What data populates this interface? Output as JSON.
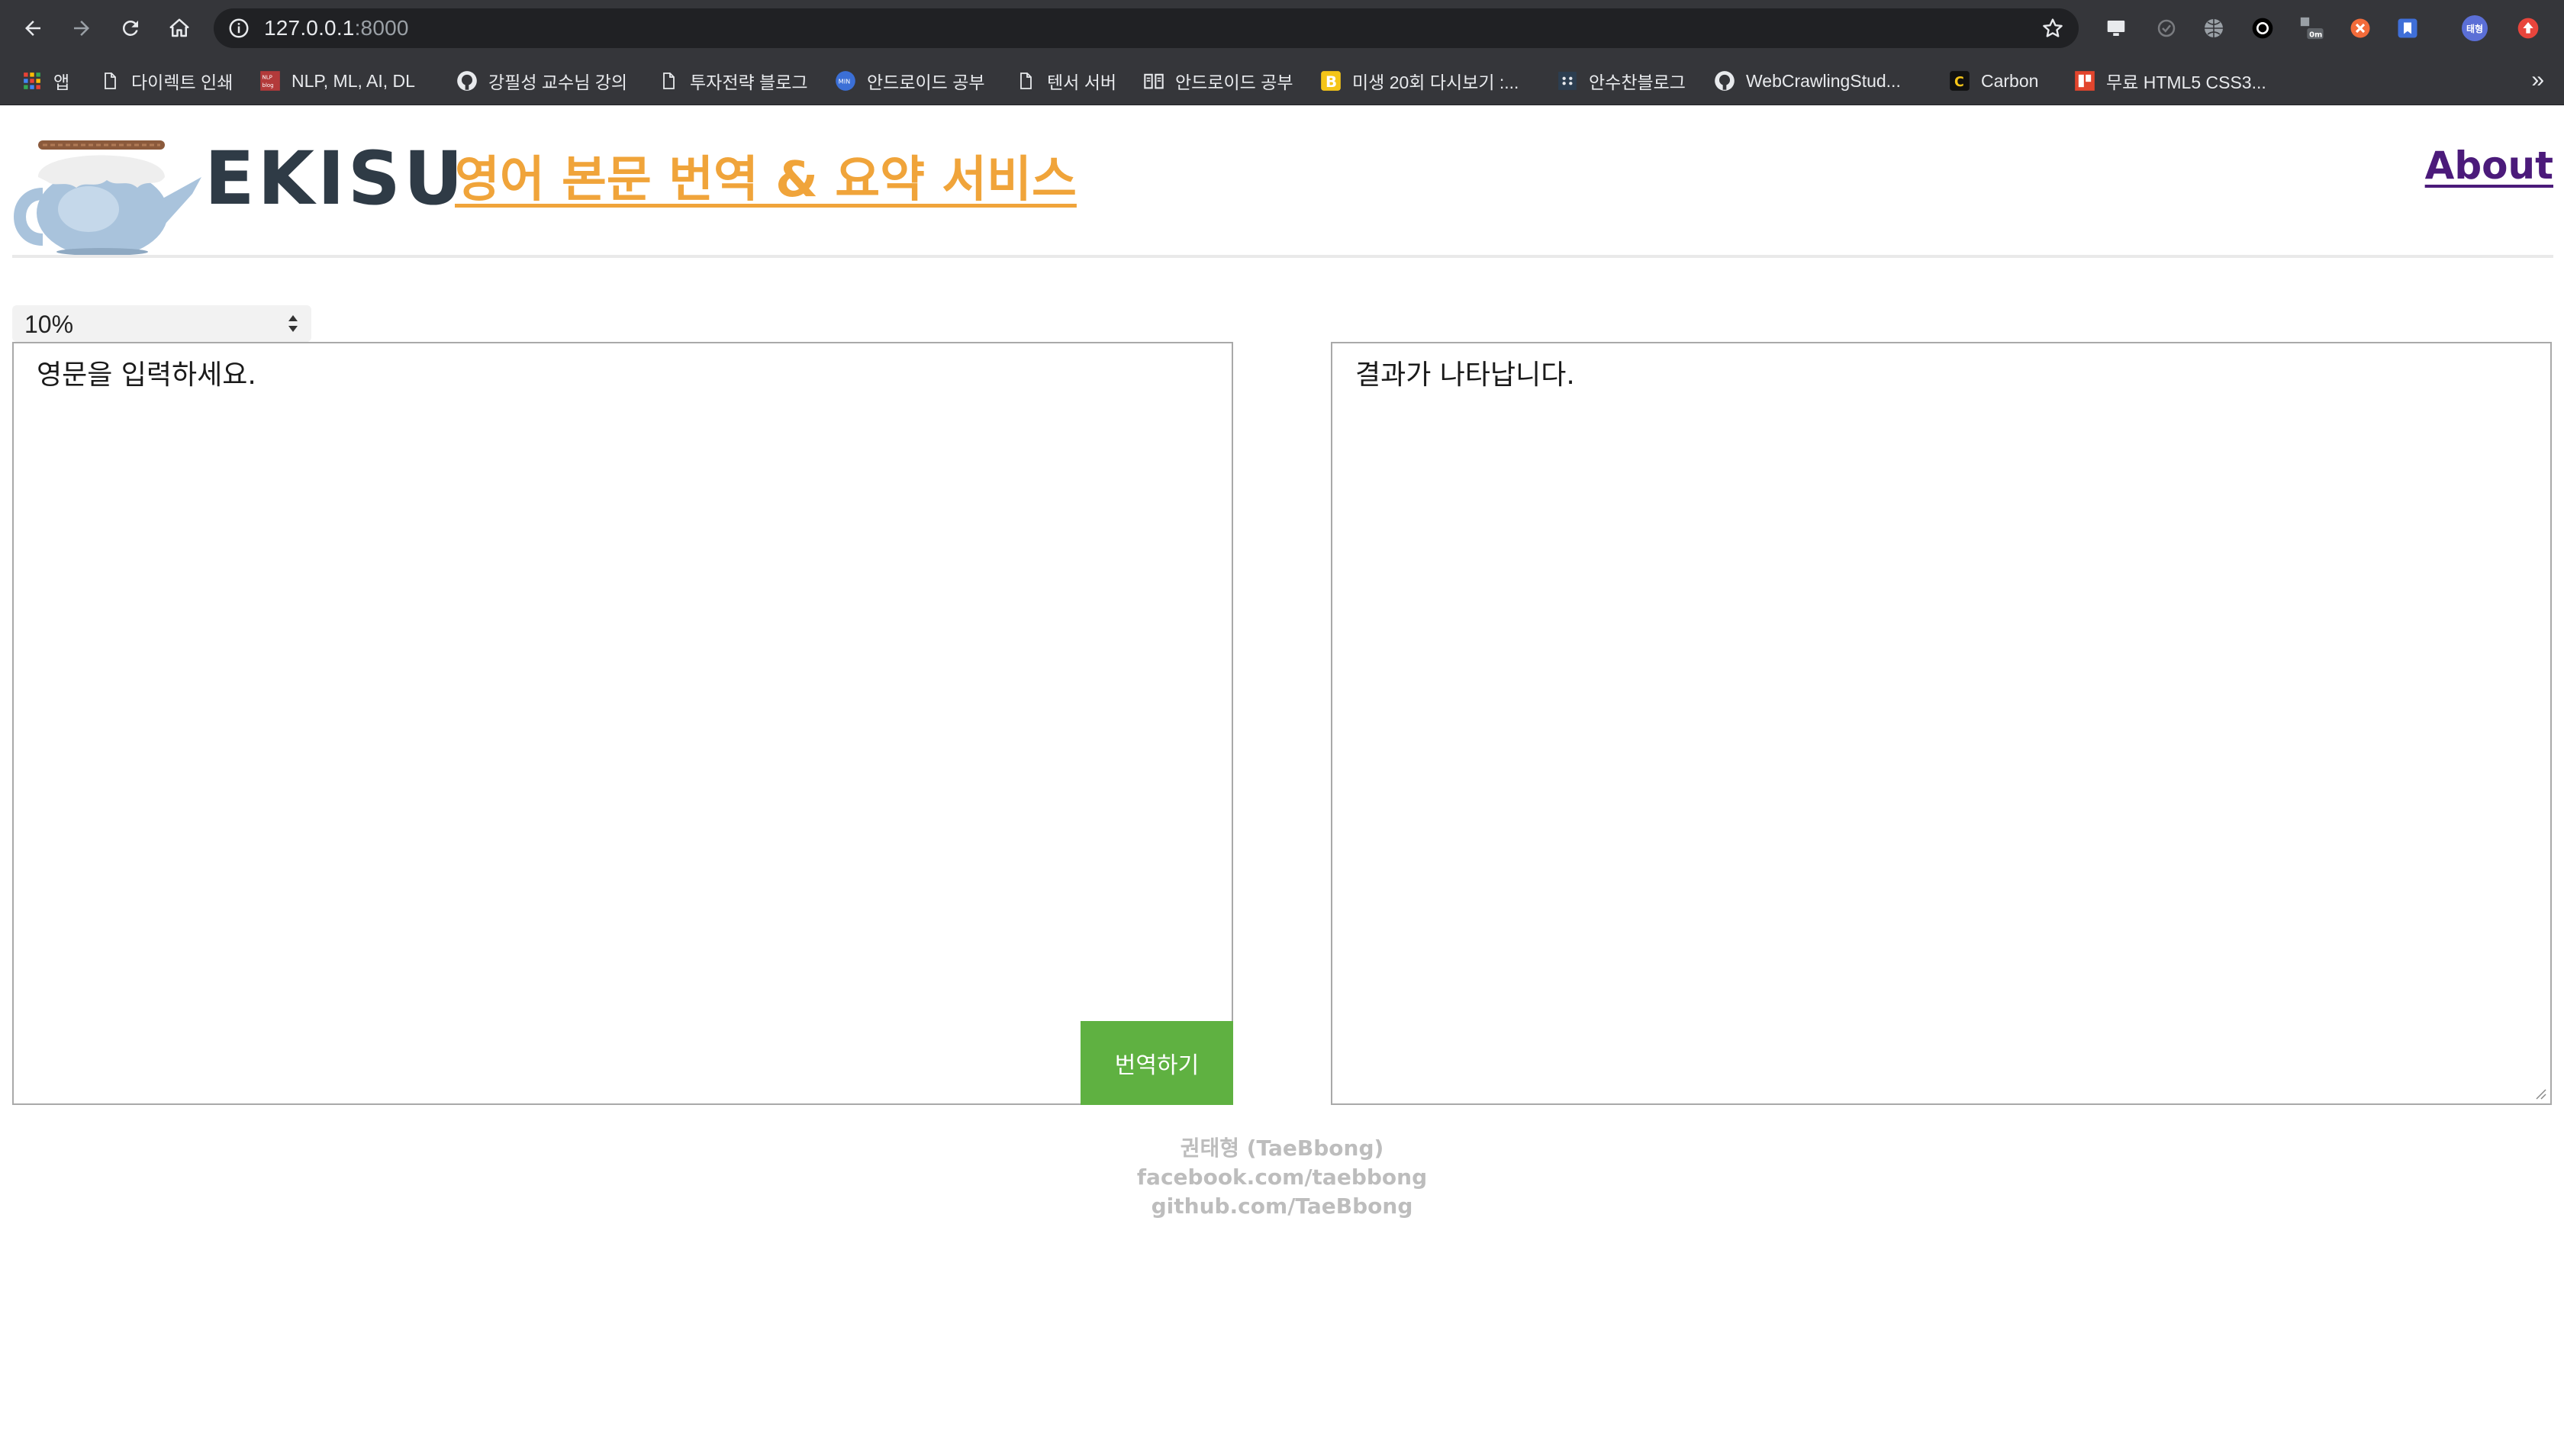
{
  "browser": {
    "url_host": "127.0.0.1",
    "url_port": ":8000",
    "profile_badge": "태형",
    "bookmarks": [
      {
        "label": "앱",
        "icon": "apps-grid-icon"
      },
      {
        "label": "다이렉트 인쇄",
        "icon": "page-icon"
      },
      {
        "label": "NLP, ML, AI, DL",
        "icon": "nlp-blog-icon"
      },
      {
        "label": "강필성 교수님 강의",
        "icon": "github-icon"
      },
      {
        "label": "투자전략 블로그",
        "icon": "page-icon"
      },
      {
        "label": "안드로이드 공부",
        "icon": "blue-circle-icon"
      },
      {
        "label": "텐서 서버",
        "icon": "page-icon"
      },
      {
        "label": "안드로이드 공부",
        "icon": "book-icon"
      },
      {
        "label": "미생 20회 다시보기 :...",
        "icon": "yellow-b-icon"
      },
      {
        "label": "안수찬블로그",
        "icon": "dots-icon"
      },
      {
        "label": "WebCrawlingStud...",
        "icon": "github-icon"
      },
      {
        "label": "Carbon",
        "icon": "carbon-icon"
      },
      {
        "label": "무료 HTML5 CSS3...",
        "icon": "red-square-icon"
      }
    ],
    "more": "»"
  },
  "header": {
    "logo_text": "EKISU",
    "title": "영어 본문 번역 & 요약 서비스",
    "about": "About"
  },
  "ratio": {
    "selected": "10%"
  },
  "input": {
    "placeholder": "영문을 입력하세요.",
    "button": "번역하기"
  },
  "output": {
    "placeholder": "결과가 나타납니다."
  },
  "footer": {
    "name": "권태형 (TaeBbong)",
    "facebook": "facebook.com/taebbong",
    "github": "github.com/TaeBbong"
  },
  "colors": {
    "title": "#f0a43a",
    "about": "#4b1a7a",
    "button": "#5fb141",
    "logo_text": "#2f3b46",
    "footer": "#bdbdbd"
  }
}
